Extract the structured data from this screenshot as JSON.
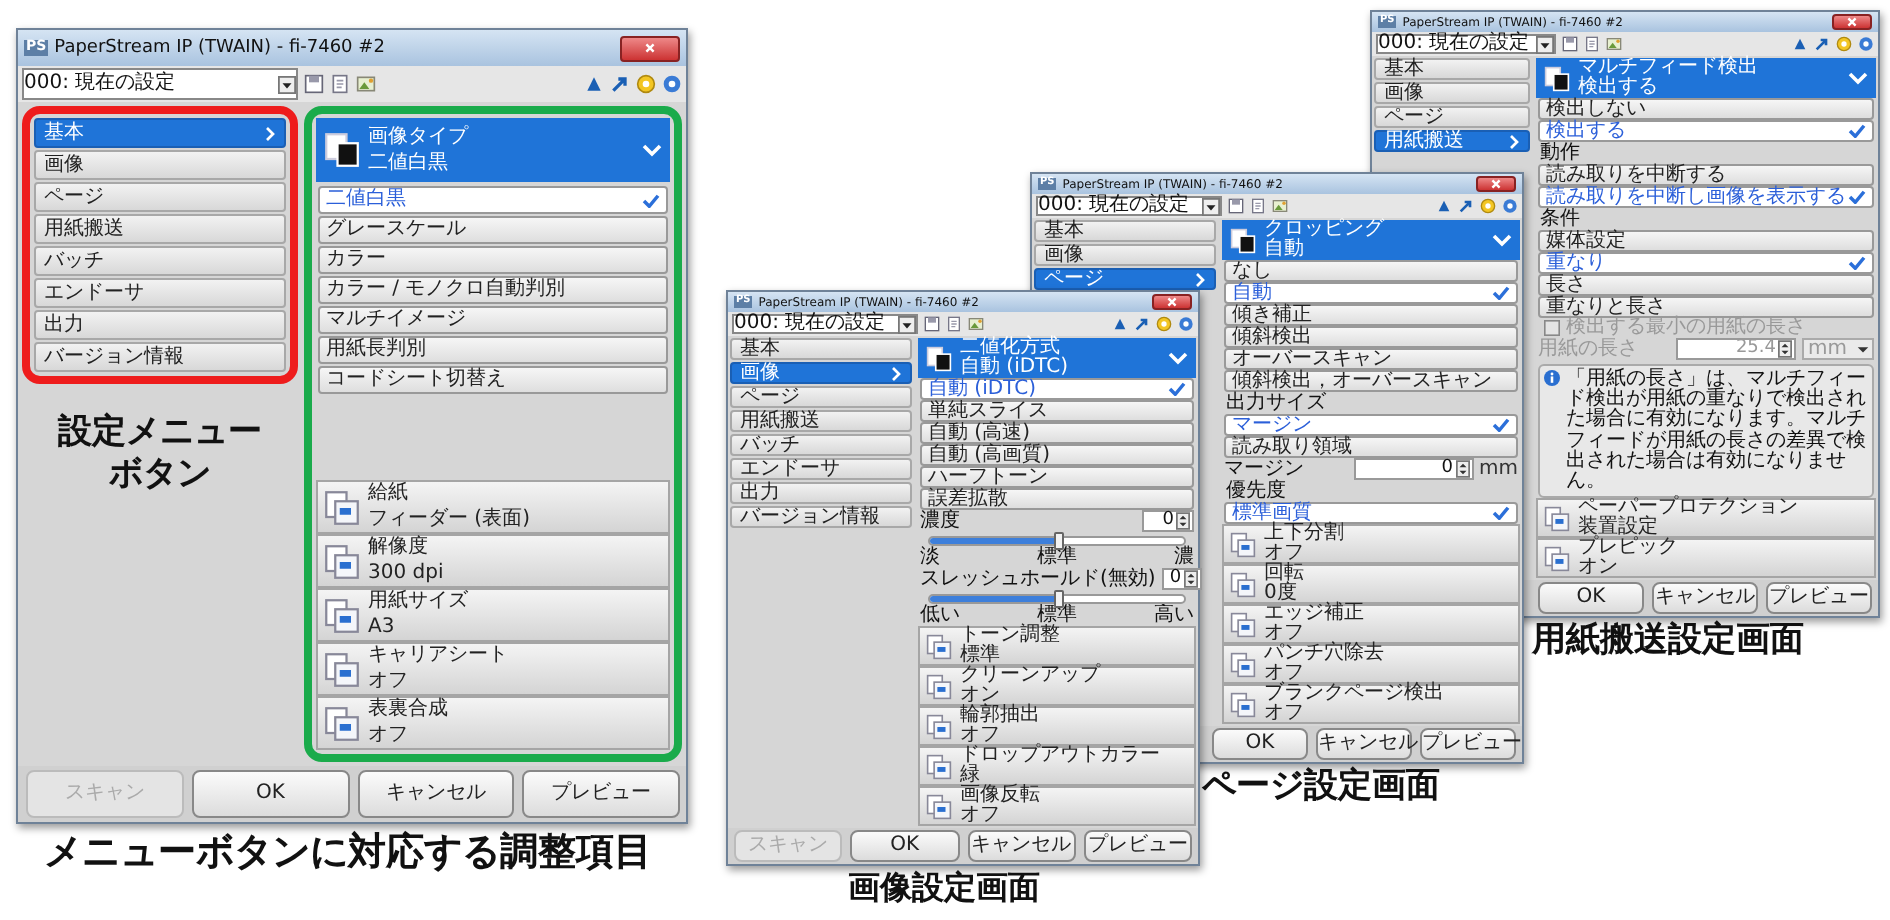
{
  "windows": [
    {
      "badge": "PS",
      "title": "PaperStream IP (TWAIN) - fi-7460 #2",
      "profile": "000: 現在の設定",
      "menu": [
        {
          "label": "基本",
          "selected": true
        },
        {
          "label": "画像",
          "selected": false
        },
        {
          "label": "ページ",
          "selected": false
        },
        {
          "label": "用紙搬送",
          "selected": false
        },
        {
          "label": "バッチ",
          "selected": false
        },
        {
          "label": "エンドーサ",
          "selected": false
        },
        {
          "label": "出力",
          "selected": false
        },
        {
          "label": "バージョン情報",
          "selected": false
        }
      ],
      "menu_caption": "設定メニューボタン",
      "header": {
        "title": "画像タイプ",
        "value": "二値白黒"
      },
      "sections": [
        {
          "kind": "option",
          "label": "二値白黒",
          "selected": true
        },
        {
          "kind": "option",
          "label": "グレースケール",
          "selected": false
        },
        {
          "kind": "option",
          "label": "カラー",
          "selected": false
        },
        {
          "kind": "option",
          "label": "カラー / モノクロ自動判別",
          "selected": false
        },
        {
          "kind": "option",
          "label": "マルチイメージ",
          "selected": false
        },
        {
          "kind": "option",
          "label": "用紙長判別",
          "selected": false
        },
        {
          "kind": "option",
          "label": "コードシート切替え",
          "selected": false
        }
      ],
      "items": [
        {
          "title": "給紙",
          "value": "フィーダー (表面)"
        },
        {
          "title": "解像度",
          "value": "300 dpi"
        },
        {
          "title": "用紙サイズ",
          "value": "A3"
        },
        {
          "title": "キャリアシート",
          "value": "オフ"
        },
        {
          "title": "表裏合成",
          "value": "オフ"
        }
      ],
      "buttons": [
        {
          "label": "スキャン",
          "disabled": true
        },
        {
          "label": "OK",
          "disabled": false
        },
        {
          "label": "キャンセル",
          "disabled": false
        },
        {
          "label": "プレビュー",
          "disabled": false
        }
      ]
    },
    {
      "badge": "PS",
      "title": "PaperStream IP (TWAIN) - fi-7460 #2",
      "profile": "000: 現在の設定",
      "menu": [
        {
          "label": "基本",
          "selected": false
        },
        {
          "label": "画像",
          "selected": true
        },
        {
          "label": "ページ",
          "selected": false
        },
        {
          "label": "用紙搬送",
          "selected": false
        },
        {
          "label": "バッチ",
          "selected": false
        },
        {
          "label": "エンドーサ",
          "selected": false
        },
        {
          "label": "出力",
          "selected": false
        },
        {
          "label": "バージョン情報",
          "selected": false
        }
      ],
      "header": {
        "title": "二値化方式",
        "value": "自動 (iDTC)"
      },
      "sections": [
        {
          "kind": "option",
          "label": "自動 (iDTC)",
          "selected": true
        },
        {
          "kind": "option",
          "label": "単純スライス",
          "selected": false
        },
        {
          "kind": "option",
          "label": "自動 (高速)",
          "selected": false
        },
        {
          "kind": "option",
          "label": "自動 (高画質)",
          "selected": false
        },
        {
          "kind": "option",
          "label": "ハーフトーン",
          "selected": false
        },
        {
          "kind": "option",
          "label": "誤差拡散",
          "selected": false
        },
        {
          "kind": "slider",
          "label": "濃度",
          "value": "0",
          "level": 0.5,
          "scale": [
            "淡",
            "標準",
            "濃"
          ]
        },
        {
          "kind": "slider",
          "label": "スレッシュホールド(無効)",
          "value": "0",
          "level": 0.5,
          "scale": [
            "低い",
            "標準",
            "高い"
          ]
        }
      ],
      "items": [
        {
          "title": "トーン調整",
          "value": "標準"
        },
        {
          "title": "クリーンアップ",
          "value": "オン"
        },
        {
          "title": "輪郭抽出",
          "value": "オフ"
        },
        {
          "title": "ドロップアウトカラー",
          "value": "緑"
        },
        {
          "title": "画像反転",
          "value": "オフ"
        }
      ],
      "buttons": [
        {
          "label": "スキャン",
          "disabled": true
        },
        {
          "label": "OK",
          "disabled": false
        },
        {
          "label": "キャンセル",
          "disabled": false
        },
        {
          "label": "プレビュー",
          "disabled": false
        }
      ]
    },
    {
      "badge": "PS",
      "title": "PaperStream IP (TWAIN) - fi-7460 #2",
      "profile": "000: 現在の設定",
      "menu": [
        {
          "label": "基本",
          "selected": false
        },
        {
          "label": "画像",
          "selected": false
        },
        {
          "label": "ページ",
          "selected": true
        }
      ],
      "header": {
        "title": "クロッピング",
        "value": "自動"
      },
      "sections": [
        {
          "kind": "option",
          "label": "なし",
          "selected": false
        },
        {
          "kind": "option",
          "label": "自動",
          "selected": true
        },
        {
          "kind": "option",
          "label": "傾き補正",
          "selected": false
        },
        {
          "kind": "option",
          "label": "傾斜検出",
          "selected": false
        },
        {
          "kind": "option",
          "label": "オーバースキャン",
          "selected": false
        },
        {
          "kind": "option",
          "label": "傾斜検出，オーバースキャン",
          "selected": false
        },
        {
          "kind": "heading",
          "label": "出力サイズ"
        },
        {
          "kind": "option",
          "label": "マージン",
          "selected": true
        },
        {
          "kind": "option",
          "label": "読み取り領域",
          "selected": false
        },
        {
          "kind": "number",
          "label": "マージン",
          "value": "0",
          "unit": "mm",
          "unit_dropdown": false,
          "disabled": false
        },
        {
          "kind": "heading",
          "label": "優先度"
        },
        {
          "kind": "option",
          "label": "標準画質",
          "selected": true
        }
      ],
      "items": [
        {
          "title": "上下分割",
          "value": "オフ"
        },
        {
          "title": "回転",
          "value": "0度"
        },
        {
          "title": "エッジ補正",
          "value": "オフ"
        },
        {
          "title": "パンチ穴除去",
          "value": "オフ"
        },
        {
          "title": "ブランクページ検出",
          "value": "オフ"
        }
      ],
      "buttons": [
        {
          "label": "OK",
          "disabled": false
        },
        {
          "label": "キャンセル",
          "disabled": false
        },
        {
          "label": "プレビュー",
          "disabled": false
        }
      ]
    },
    {
      "badge": "PS",
      "title": "PaperStream IP (TWAIN) - fi-7460 #2",
      "profile": "000: 現在の設定",
      "menu": [
        {
          "label": "基本",
          "selected": false
        },
        {
          "label": "画像",
          "selected": false
        },
        {
          "label": "ページ",
          "selected": false
        },
        {
          "label": "用紙搬送",
          "selected": true
        }
      ],
      "header": {
        "title": "マルチフィード検出",
        "value": "検出する"
      },
      "sections": [
        {
          "kind": "option",
          "label": "検出しない",
          "selected": false
        },
        {
          "kind": "option",
          "label": "検出する",
          "selected": true
        },
        {
          "kind": "heading",
          "label": "動作"
        },
        {
          "kind": "option",
          "label": "読み取りを中断する",
          "selected": false
        },
        {
          "kind": "option",
          "label": "読み取りを中断し画像を表示する",
          "selected": true
        },
        {
          "kind": "heading",
          "label": "条件"
        },
        {
          "kind": "option",
          "label": "媒体設定",
          "selected": false
        },
        {
          "kind": "option",
          "label": "重なり",
          "selected": true
        },
        {
          "kind": "option",
          "label": "長さ",
          "selected": false
        },
        {
          "kind": "option",
          "label": "重なりと長さ",
          "selected": false
        },
        {
          "kind": "checkbox",
          "label": "検出する最小の用紙の長さ",
          "checked": false,
          "disabled": true
        },
        {
          "kind": "number",
          "label": "用紙の長さ",
          "value": "25.4",
          "unit": "mm",
          "unit_dropdown": true,
          "disabled": true
        },
        {
          "kind": "note",
          "text": "「用紙の長さ」は、マルチフィード検出が用紙の重なりで検出された場合に有効になります。マルチフィードが用紙の長さの差異で検出された場合は有効になりません。"
        }
      ],
      "items": [
        {
          "title": "ペーパープロテクション",
          "value": "装置設定"
        },
        {
          "title": "プレピック",
          "value": "オン"
        }
      ],
      "buttons": [
        {
          "label": "OK",
          "disabled": false
        },
        {
          "label": "キャンセル",
          "disabled": false
        },
        {
          "label": "プレビュー",
          "disabled": false
        }
      ]
    }
  ],
  "captions": [
    "メニューボタンに対応する調整項目",
    "画像設定画面",
    "ページ設定画面",
    "用紙搬送設定画面"
  ]
}
